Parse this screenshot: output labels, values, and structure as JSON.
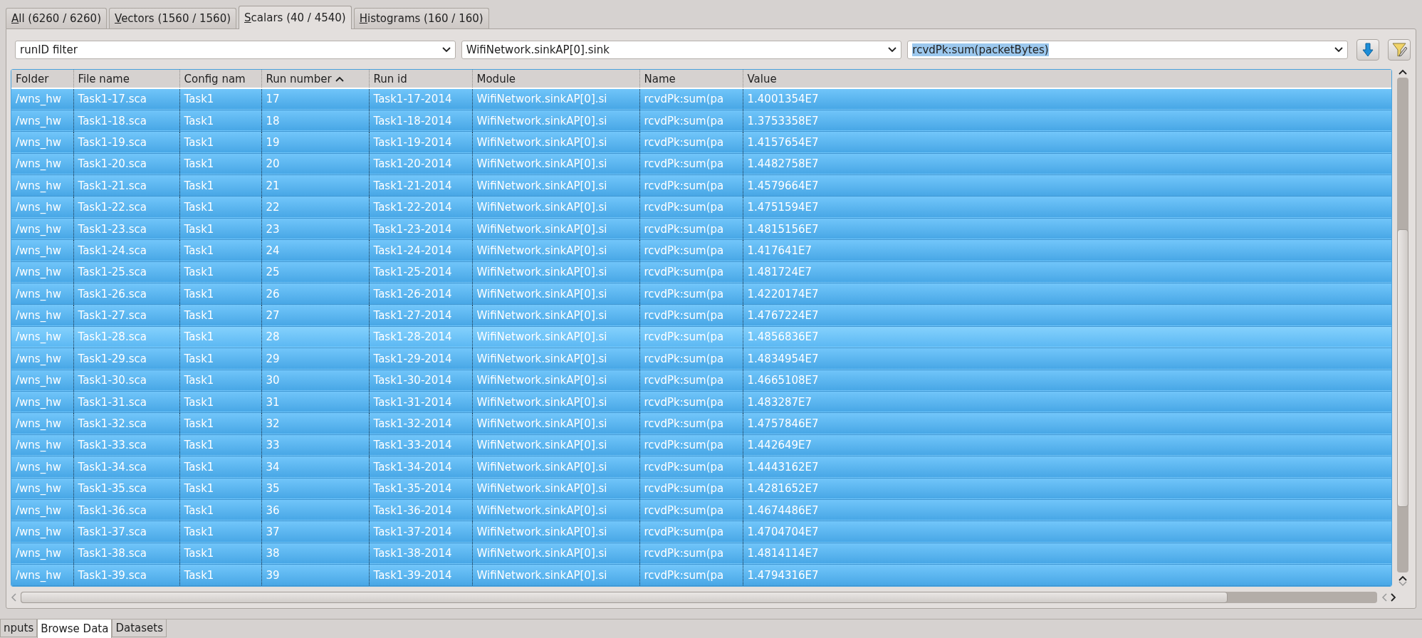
{
  "tabs": [
    {
      "label": "All (6260 / 6260)",
      "selected": false
    },
    {
      "label": "Vectors (1560 / 1560)",
      "selected": false
    },
    {
      "label": "Scalars (40 / 4540)",
      "selected": true
    },
    {
      "label": "Histograms (160 / 160)",
      "selected": false
    }
  ],
  "filters": [
    {
      "value": "runID filter",
      "text_selected": false
    },
    {
      "value": "WifiNetwork.sinkAP[0].sink",
      "text_selected": false
    },
    {
      "value": "rcvdPk:sum(packetBytes)",
      "text_selected": true
    }
  ],
  "table": {
    "columns": [
      {
        "label": "Folder",
        "sorted": false
      },
      {
        "label": "File name",
        "sorted": false
      },
      {
        "label": "Config nam",
        "sorted": false
      },
      {
        "label": "Run number",
        "sorted": true
      },
      {
        "label": "Run id",
        "sorted": false
      },
      {
        "label": "Module",
        "sorted": false
      },
      {
        "label": "Name",
        "sorted": false
      },
      {
        "label": "Value",
        "sorted": false
      }
    ],
    "rows": [
      {
        "selected": true,
        "hovered": false,
        "cells": [
          "/wns_hw",
          "Task1-17.sca",
          "Task1",
          "17",
          "Task1-17-2014",
          "WifiNetwork.sinkAP[0].si",
          "rcvdPk:sum(pa",
          "1.4001354E7"
        ]
      },
      {
        "selected": true,
        "hovered": false,
        "cells": [
          "/wns_hw",
          "Task1-18.sca",
          "Task1",
          "18",
          "Task1-18-2014",
          "WifiNetwork.sinkAP[0].si",
          "rcvdPk:sum(pa",
          "1.3753358E7"
        ]
      },
      {
        "selected": true,
        "hovered": false,
        "cells": [
          "/wns_hw",
          "Task1-19.sca",
          "Task1",
          "19",
          "Task1-19-2014",
          "WifiNetwork.sinkAP[0].si",
          "rcvdPk:sum(pa",
          "1.4157654E7"
        ]
      },
      {
        "selected": true,
        "hovered": false,
        "cells": [
          "/wns_hw",
          "Task1-20.sca",
          "Task1",
          "20",
          "Task1-20-2014",
          "WifiNetwork.sinkAP[0].si",
          "rcvdPk:sum(pa",
          "1.4482758E7"
        ]
      },
      {
        "selected": true,
        "hovered": false,
        "cells": [
          "/wns_hw",
          "Task1-21.sca",
          "Task1",
          "21",
          "Task1-21-2014",
          "WifiNetwork.sinkAP[0].si",
          "rcvdPk:sum(pa",
          "1.4579664E7"
        ]
      },
      {
        "selected": true,
        "hovered": false,
        "cells": [
          "/wns_hw",
          "Task1-22.sca",
          "Task1",
          "22",
          "Task1-22-2014",
          "WifiNetwork.sinkAP[0].si",
          "rcvdPk:sum(pa",
          "1.4751594E7"
        ]
      },
      {
        "selected": true,
        "hovered": false,
        "cells": [
          "/wns_hw",
          "Task1-23.sca",
          "Task1",
          "23",
          "Task1-23-2014",
          "WifiNetwork.sinkAP[0].si",
          "rcvdPk:sum(pa",
          "1.4815156E7"
        ]
      },
      {
        "selected": true,
        "hovered": false,
        "cells": [
          "/wns_hw",
          "Task1-24.sca",
          "Task1",
          "24",
          "Task1-24-2014",
          "WifiNetwork.sinkAP[0].si",
          "rcvdPk:sum(pa",
          "1.417641E7"
        ]
      },
      {
        "selected": true,
        "hovered": false,
        "cells": [
          "/wns_hw",
          "Task1-25.sca",
          "Task1",
          "25",
          "Task1-25-2014",
          "WifiNetwork.sinkAP[0].si",
          "rcvdPk:sum(pa",
          "1.481724E7"
        ]
      },
      {
        "selected": true,
        "hovered": false,
        "cells": [
          "/wns_hw",
          "Task1-26.sca",
          "Task1",
          "26",
          "Task1-26-2014",
          "WifiNetwork.sinkAP[0].si",
          "rcvdPk:sum(pa",
          "1.4220174E7"
        ]
      },
      {
        "selected": true,
        "hovered": false,
        "cells": [
          "/wns_hw",
          "Task1-27.sca",
          "Task1",
          "27",
          "Task1-27-2014",
          "WifiNetwork.sinkAP[0].si",
          "rcvdPk:sum(pa",
          "1.4767224E7"
        ]
      },
      {
        "selected": true,
        "hovered": true,
        "cells": [
          "/wns_hw",
          "Task1-28.sca",
          "Task1",
          "28",
          "Task1-28-2014",
          "WifiNetwork.sinkAP[0].si",
          "rcvdPk:sum(pa",
          "1.4856836E7"
        ]
      },
      {
        "selected": true,
        "hovered": false,
        "cells": [
          "/wns_hw",
          "Task1-29.sca",
          "Task1",
          "29",
          "Task1-29-2014",
          "WifiNetwork.sinkAP[0].si",
          "rcvdPk:sum(pa",
          "1.4834954E7"
        ]
      },
      {
        "selected": true,
        "hovered": false,
        "cells": [
          "/wns_hw",
          "Task1-30.sca",
          "Task1",
          "30",
          "Task1-30-2014",
          "WifiNetwork.sinkAP[0].si",
          "rcvdPk:sum(pa",
          "1.4665108E7"
        ]
      },
      {
        "selected": true,
        "hovered": false,
        "cells": [
          "/wns_hw",
          "Task1-31.sca",
          "Task1",
          "31",
          "Task1-31-2014",
          "WifiNetwork.sinkAP[0].si",
          "rcvdPk:sum(pa",
          "1.483287E7"
        ]
      },
      {
        "selected": true,
        "hovered": false,
        "cells": [
          "/wns_hw",
          "Task1-32.sca",
          "Task1",
          "32",
          "Task1-32-2014",
          "WifiNetwork.sinkAP[0].si",
          "rcvdPk:sum(pa",
          "1.4757846E7"
        ]
      },
      {
        "selected": true,
        "hovered": false,
        "cells": [
          "/wns_hw",
          "Task1-33.sca",
          "Task1",
          "33",
          "Task1-33-2014",
          "WifiNetwork.sinkAP[0].si",
          "rcvdPk:sum(pa",
          "1.442649E7"
        ]
      },
      {
        "selected": true,
        "hovered": false,
        "cells": [
          "/wns_hw",
          "Task1-34.sca",
          "Task1",
          "34",
          "Task1-34-2014",
          "WifiNetwork.sinkAP[0].si",
          "rcvdPk:sum(pa",
          "1.4443162E7"
        ]
      },
      {
        "selected": true,
        "hovered": false,
        "cells": [
          "/wns_hw",
          "Task1-35.sca",
          "Task1",
          "35",
          "Task1-35-2014",
          "WifiNetwork.sinkAP[0].si",
          "rcvdPk:sum(pa",
          "1.4281652E7"
        ]
      },
      {
        "selected": true,
        "hovered": false,
        "cells": [
          "/wns_hw",
          "Task1-36.sca",
          "Task1",
          "36",
          "Task1-36-2014",
          "WifiNetwork.sinkAP[0].si",
          "rcvdPk:sum(pa",
          "1.4674486E7"
        ]
      },
      {
        "selected": true,
        "hovered": false,
        "cells": [
          "/wns_hw",
          "Task1-37.sca",
          "Task1",
          "37",
          "Task1-37-2014",
          "WifiNetwork.sinkAP[0].si",
          "rcvdPk:sum(pa",
          "1.4704704E7"
        ]
      },
      {
        "selected": true,
        "hovered": false,
        "cells": [
          "/wns_hw",
          "Task1-38.sca",
          "Task1",
          "38",
          "Task1-38-2014",
          "WifiNetwork.sinkAP[0].si",
          "rcvdPk:sum(pa",
          "1.4814114E7"
        ]
      },
      {
        "selected": true,
        "hovered": false,
        "cells": [
          "/wns_hw",
          "Task1-39.sca",
          "Task1",
          "39",
          "Task1-39-2014",
          "WifiNetwork.sinkAP[0].si",
          "rcvdPk:sum(pa",
          "1.4794316E7"
        ]
      }
    ]
  },
  "bottom_tabs": [
    {
      "label": "nputs",
      "selected": false
    },
    {
      "label": "Browse Data",
      "selected": true
    },
    {
      "label": "Datasets",
      "selected": false
    }
  ]
}
